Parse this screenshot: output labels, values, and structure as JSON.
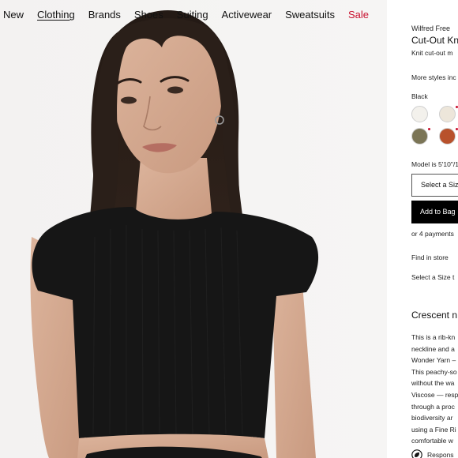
{
  "nav": {
    "items": [
      {
        "label": "New"
      },
      {
        "label": "Clothing",
        "active": true
      },
      {
        "label": "Brands"
      },
      {
        "label": "Shoes"
      },
      {
        "label": "Suiting"
      },
      {
        "label": "Activewear"
      },
      {
        "label": "Sweatsuits"
      },
      {
        "label": "Sale",
        "sale": true
      }
    ]
  },
  "product": {
    "brand": "Wilfred Free",
    "name": "Cut-Out Kn",
    "description": "Knit cut-out m",
    "more_styles": "More styles inc",
    "color_label": "Black",
    "swatches": [
      {
        "color": "#f3f1ec",
        "icon": "swatch-cream"
      },
      {
        "color": "#ede6da",
        "icon": "swatch-ivory"
      },
      {
        "color": "#7b7556",
        "icon": "swatch-olive"
      },
      {
        "color": "#b8512c",
        "icon": "swatch-rust"
      }
    ],
    "model_info": "Model is 5'10\"/1",
    "size_select": "Select a Siz",
    "add_to_bag": "Add to Bag",
    "payments": "or 4 payments",
    "find_in_store": "Find in store",
    "select_size_note": "Select a Size t"
  },
  "details": {
    "title": "Crescent n",
    "lines": [
      "This is a rib-kn",
      "neckline and a",
      "Wonder Yarn –",
      "This peachy-so",
      "without the wa",
      "Viscose — resp",
      "through a proc",
      "biodiversity ar",
      "using a Fine Ri",
      "comfortable w"
    ],
    "responsible_label": "Respons"
  },
  "colors": {
    "sale": "#c8102e",
    "accent": "#000000"
  }
}
